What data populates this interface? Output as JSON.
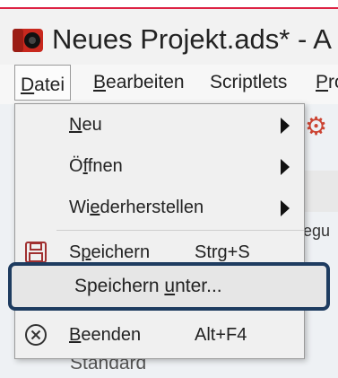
{
  "window": {
    "title": "Neues Projekt.ads* - A",
    "app_icon": "aquasoft-app-icon"
  },
  "menubar": {
    "items": [
      {
        "label": "Datei",
        "accel": "D"
      },
      {
        "label": "Bearbeiten",
        "accel": "B"
      },
      {
        "label": "Scriptlets",
        "accel": ""
      },
      {
        "label": "Pro",
        "accel": "P"
      }
    ]
  },
  "background": {
    "partial_text": "egu",
    "bottom_text": "Standard"
  },
  "file_menu": {
    "items": [
      {
        "label": "Neu",
        "accel": "N",
        "submenu": true
      },
      {
        "label": "Öffnen",
        "accel": "f",
        "submenu": true
      },
      {
        "label": "Wiederherstellen",
        "accel": "e",
        "submenu": true
      },
      {
        "label": "Speichern",
        "accel": "p",
        "shortcut": "Strg+S",
        "icon": "save-icon"
      },
      {
        "label": "Speichern unter...",
        "accel": "u",
        "highlighted": true
      },
      {
        "label": "Beenden",
        "accel": "B",
        "shortcut": "Alt+F4",
        "icon": "close-circle-icon"
      }
    ]
  }
}
